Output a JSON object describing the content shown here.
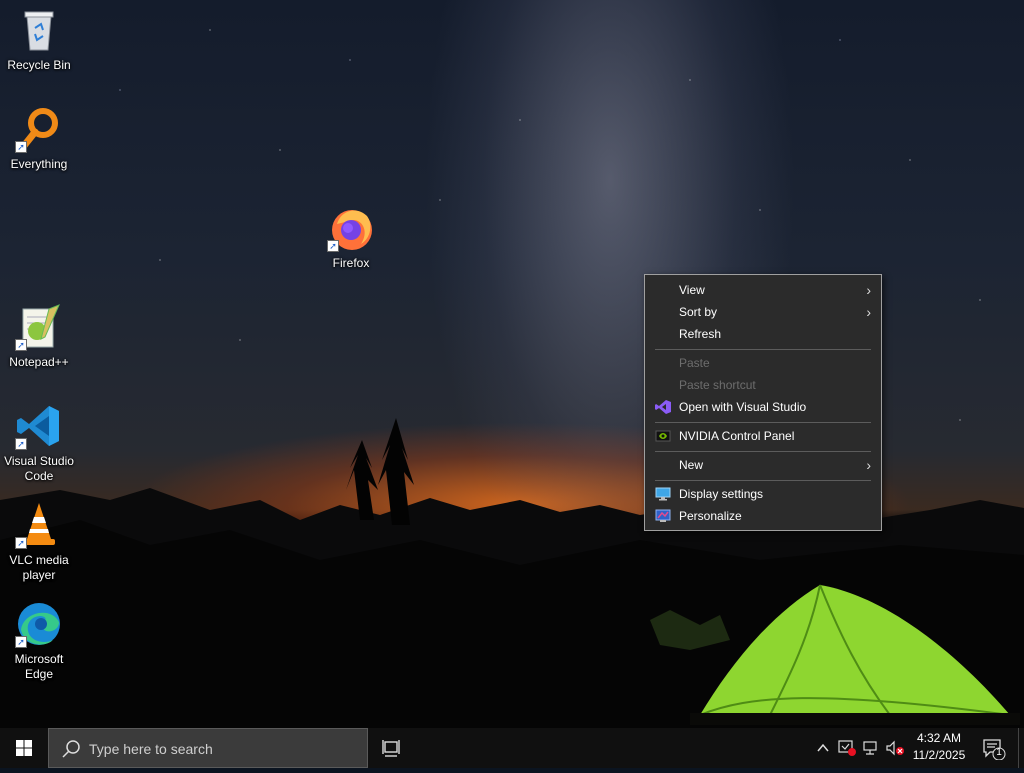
{
  "desktop": {
    "icons": [
      {
        "label": "Recycle Bin"
      },
      {
        "label": "Everything"
      },
      {
        "label": "Firefox"
      },
      {
        "label": "Notepad++"
      },
      {
        "label": "Visual Studio Code"
      },
      {
        "label": "VLC media player"
      },
      {
        "label": "Microsoft Edge"
      }
    ]
  },
  "context_menu": {
    "items": [
      {
        "label": "View",
        "enabled": true,
        "submenu": true
      },
      {
        "label": "Sort by",
        "enabled": true,
        "submenu": true
      },
      {
        "label": "Refresh",
        "enabled": true
      },
      {
        "label": "Paste",
        "enabled": false
      },
      {
        "label": "Paste shortcut",
        "enabled": false
      },
      {
        "label": "Open with Visual Studio",
        "enabled": true,
        "icon": "visual-studio-icon"
      },
      {
        "label": "NVIDIA Control Panel",
        "enabled": true,
        "icon": "nvidia-icon"
      },
      {
        "label": "New",
        "enabled": true,
        "submenu": true
      },
      {
        "label": "Display settings",
        "enabled": true,
        "icon": "display-icon"
      },
      {
        "label": "Personalize",
        "enabled": true,
        "icon": "personalize-icon"
      }
    ]
  },
  "taskbar": {
    "search_placeholder": "Type here to search",
    "clock": {
      "time": "4:32 AM",
      "date": "11/2/2025"
    },
    "notification_count": "1"
  },
  "colors": {
    "menu_bg": "#2b2b2b",
    "taskbar_bg": "#101010",
    "accent_blue": "#0078d7"
  }
}
